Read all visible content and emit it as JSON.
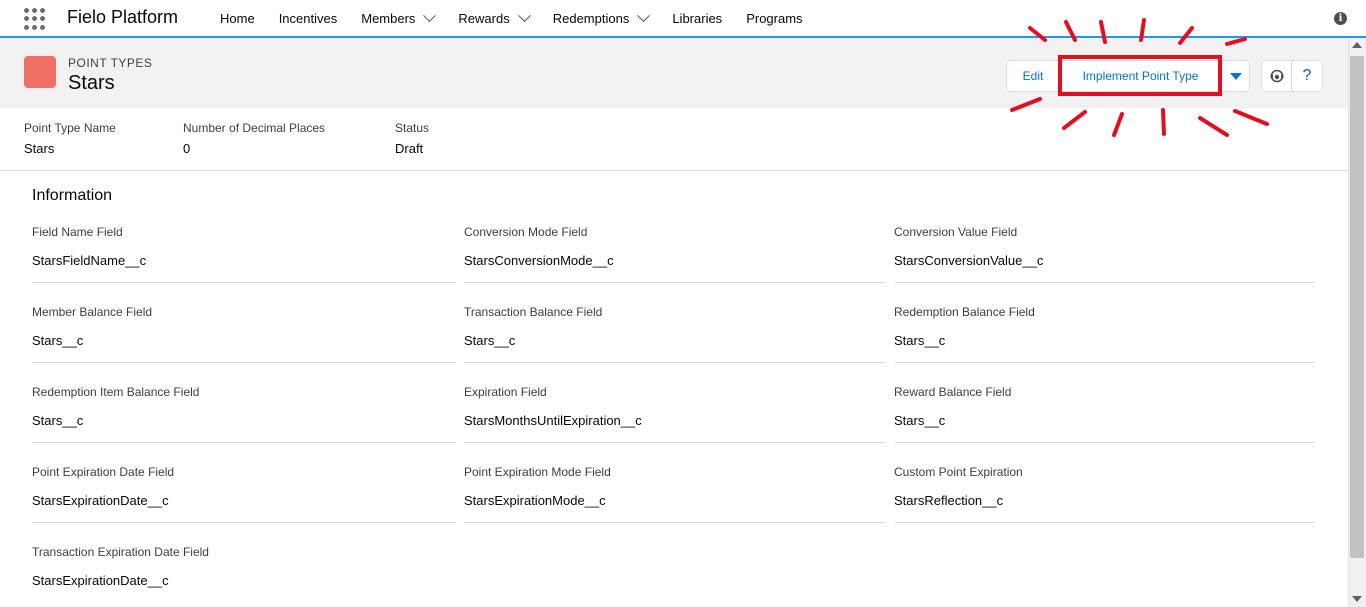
{
  "app": {
    "name": "Fielo Platform"
  },
  "nav": {
    "items": [
      {
        "label": "Home",
        "has_dropdown": false
      },
      {
        "label": "Incentives",
        "has_dropdown": false
      },
      {
        "label": "Members",
        "has_dropdown": true
      },
      {
        "label": "Rewards",
        "has_dropdown": true
      },
      {
        "label": "Redemptions",
        "has_dropdown": true
      },
      {
        "label": "Libraries",
        "has_dropdown": false
      },
      {
        "label": "Programs",
        "has_dropdown": false
      }
    ]
  },
  "header": {
    "object_label": "POINT TYPES",
    "record_title": "Stars",
    "buttons": {
      "edit": "Edit",
      "implement": "Implement Point Type"
    }
  },
  "highlights": [
    {
      "label": "Point Type Name",
      "value": "Stars"
    },
    {
      "label": "Number of Decimal Places",
      "value": "0"
    },
    {
      "label": "Status",
      "value": "Draft"
    }
  ],
  "section": {
    "title": "Information",
    "fields": [
      {
        "label": "Field Name Field",
        "value": "StarsFieldName__c"
      },
      {
        "label": "Conversion Mode Field",
        "value": "StarsConversionMode__c"
      },
      {
        "label": "Conversion Value Field",
        "value": "StarsConversionValue__c"
      },
      {
        "label": "Member Balance Field",
        "value": "Stars__c"
      },
      {
        "label": "Transaction Balance Field",
        "value": "Stars__c"
      },
      {
        "label": "Redemption Balance Field",
        "value": "Stars__c"
      },
      {
        "label": "Redemption Item Balance Field",
        "value": "Stars__c"
      },
      {
        "label": "Expiration Field",
        "value": "StarsMonthsUntilExpiration__c"
      },
      {
        "label": "Reward Balance Field",
        "value": "Stars__c"
      },
      {
        "label": "Point Expiration Date Field",
        "value": "StarsExpirationDate__c"
      },
      {
        "label": "Point Expiration Mode Field",
        "value": "StarsExpirationMode__c"
      },
      {
        "label": "Custom Point Expiration",
        "value": "StarsReflection__c"
      },
      {
        "label": "Transaction Expiration Date Field",
        "value": "StarsExpirationDate__c"
      }
    ]
  },
  "colors": {
    "accent": "#0176d3",
    "object_icon": "#f26f65",
    "annotation": "#e60d20"
  },
  "icons": {
    "app_launcher": "app-launcher-icon",
    "info": "info-icon",
    "caret": "caret-down-icon",
    "agent": "agent-icon",
    "help": "help-icon"
  }
}
